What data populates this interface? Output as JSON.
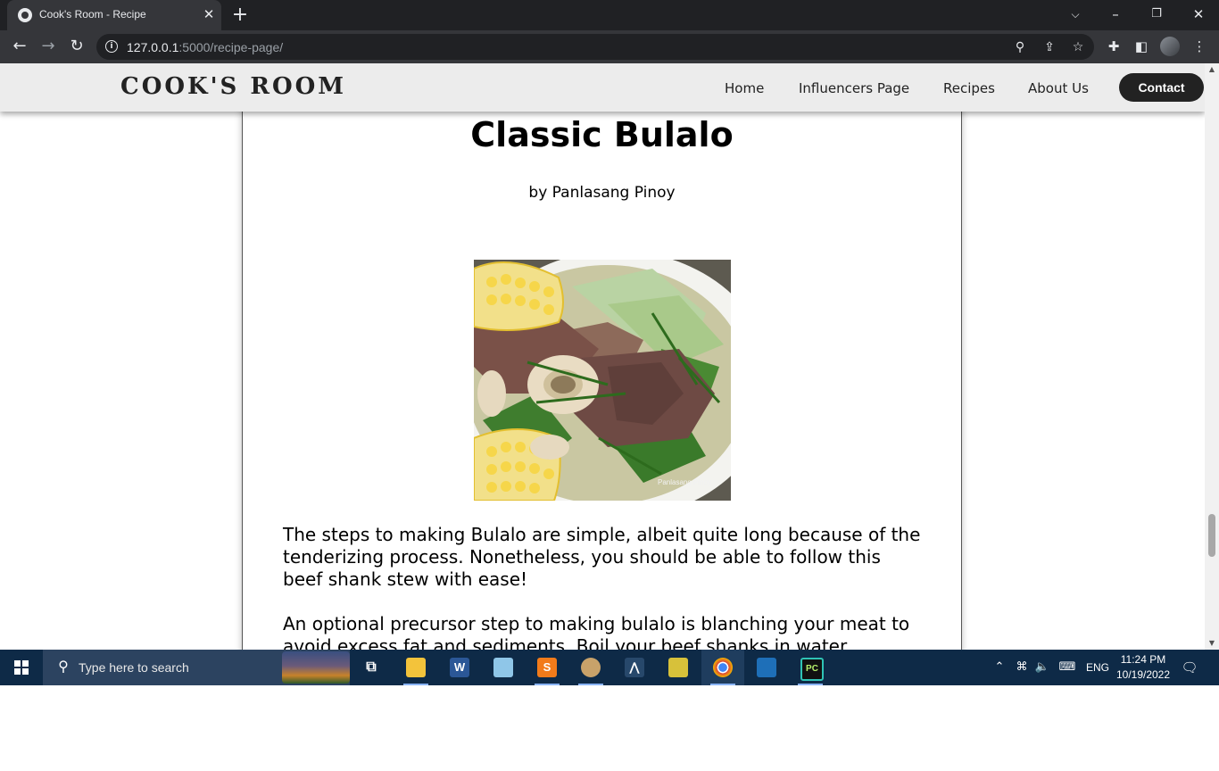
{
  "browser": {
    "tab_title": "Cook's Room - Recipe",
    "url_host": "127.0.0.1",
    "url_rest": ":5000/recipe-page/"
  },
  "site": {
    "brand": "COOK'S ROOM",
    "nav": [
      "Home",
      "Influencers Page",
      "Recipes",
      "About Us"
    ],
    "contact_label": "Contact"
  },
  "recipe": {
    "title": "Classic Bulalo",
    "author": "by Panlasang Pinoy",
    "image_watermark": "Panlasang Pinoy",
    "paragraphs": [
      "The steps to making Bulalo are simple, albeit quite long because of the tenderizing process. Nonetheless, you should be able to follow this beef shank stew with ease!",
      "An optional precursor step to making bulalo is blanching your meat to avoid excess fat and sediments. Boil your beef shanks in water"
    ]
  },
  "taskbar": {
    "search_placeholder": "Type here to search",
    "language": "ENG",
    "time": "11:24 PM",
    "date": "10/19/2022",
    "pinned_apps": [
      "task-view",
      "file-explorer",
      "word",
      "notepad",
      "sublime-text",
      "paint",
      "mysql-workbench",
      "python-idle",
      "chrome",
      "virtualbox",
      "pycharm"
    ]
  }
}
